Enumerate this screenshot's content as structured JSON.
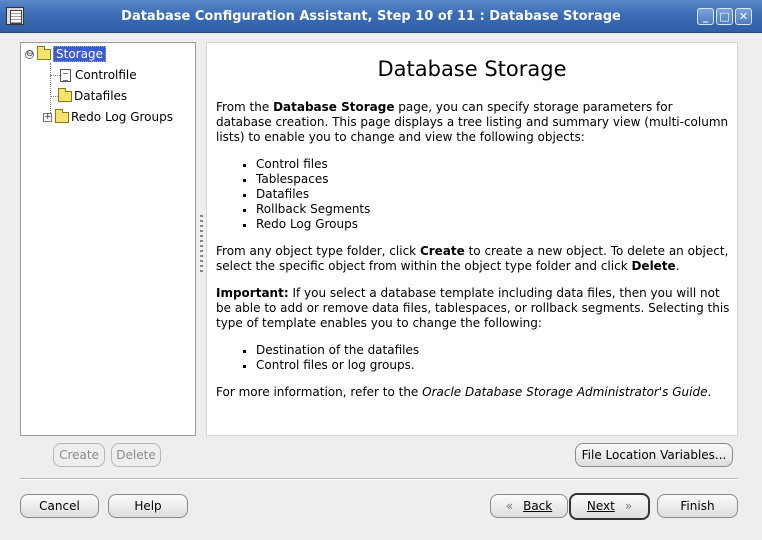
{
  "window": {
    "title": "Database Configuration Assistant, Step 10 of 11 : Database Storage",
    "controls": {
      "minimize": "_",
      "maximize": "□",
      "close": "✕"
    }
  },
  "tree": {
    "root": {
      "label": "Storage",
      "expander": "⊖"
    },
    "items": [
      {
        "label": "Controlfile",
        "icon": "file-icon"
      },
      {
        "label": "Datafiles",
        "icon": "folder-icon"
      },
      {
        "label": "Redo Log Groups",
        "icon": "folder-icon",
        "expander": "+"
      }
    ]
  },
  "content": {
    "title": "Database Storage",
    "p1_a": "From the ",
    "p1_b": "Database Storage",
    "p1_c": " page, you can specify storage parameters for database creation. This page displays a tree listing and summary view (multi-column lists) to enable you to change and view the following objects:",
    "list1": [
      "Control files",
      "Tablespaces",
      "Datafiles",
      "Rollback Segments",
      "Redo Log Groups"
    ],
    "p2_a": "From any object type folder, click ",
    "p2_b": "Create",
    "p2_c": " to create a new object. To delete an object, select the specific object from within the object type folder and click ",
    "p2_d": "Delete",
    "p2_e": ".",
    "p3_a": "Important:",
    "p3_b": " If you select a database template including data files, then you will not be able to add or remove data files, tablespaces, or rollback segments. Selecting this type of template enables you to change the following:",
    "list2": [
      "Destination of the datafiles",
      "Control files or log groups."
    ],
    "p4_a": "For more information, refer to the ",
    "p4_b": "Oracle Database Storage Administrator's Guide",
    "p4_c": "."
  },
  "buttons": {
    "create": "Create",
    "delete": "Delete",
    "file_location": "File Location Variables...",
    "cancel": "Cancel",
    "help": "Help",
    "back": "Back",
    "next": "Next",
    "finish": "Finish",
    "back_arrow": "«",
    "next_arrow": "»"
  }
}
